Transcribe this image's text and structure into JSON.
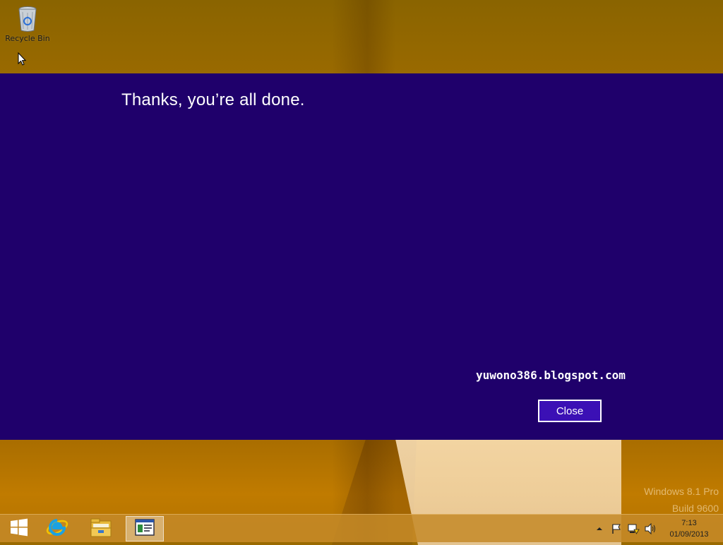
{
  "desktop": {
    "icons": [
      {
        "label": "Recycle Bin",
        "icon": "recycle-bin-icon"
      }
    ],
    "os_watermark": {
      "line1": "Windows 8.1 Pro",
      "line2": "Build 9600"
    }
  },
  "dialog": {
    "title": "Thanks, you’re all done.",
    "watermark_text": "yuwono386.blogspot.com",
    "close_label": "Close",
    "background_color": "#1f006b",
    "button_color": "#3b10b5"
  },
  "taskbar": {
    "pinned": [
      {
        "icon": "windows-start-icon"
      },
      {
        "icon": "internet-explorer-icon"
      },
      {
        "icon": "file-explorer-icon"
      },
      {
        "icon": "app-window-icon",
        "active": true
      }
    ],
    "tray": {
      "icons": [
        "show-hidden-icons-icon",
        "action-center-flag-icon",
        "network-icon",
        "volume-icon"
      ],
      "time": "7:13",
      "date": "01/09/2013"
    }
  }
}
